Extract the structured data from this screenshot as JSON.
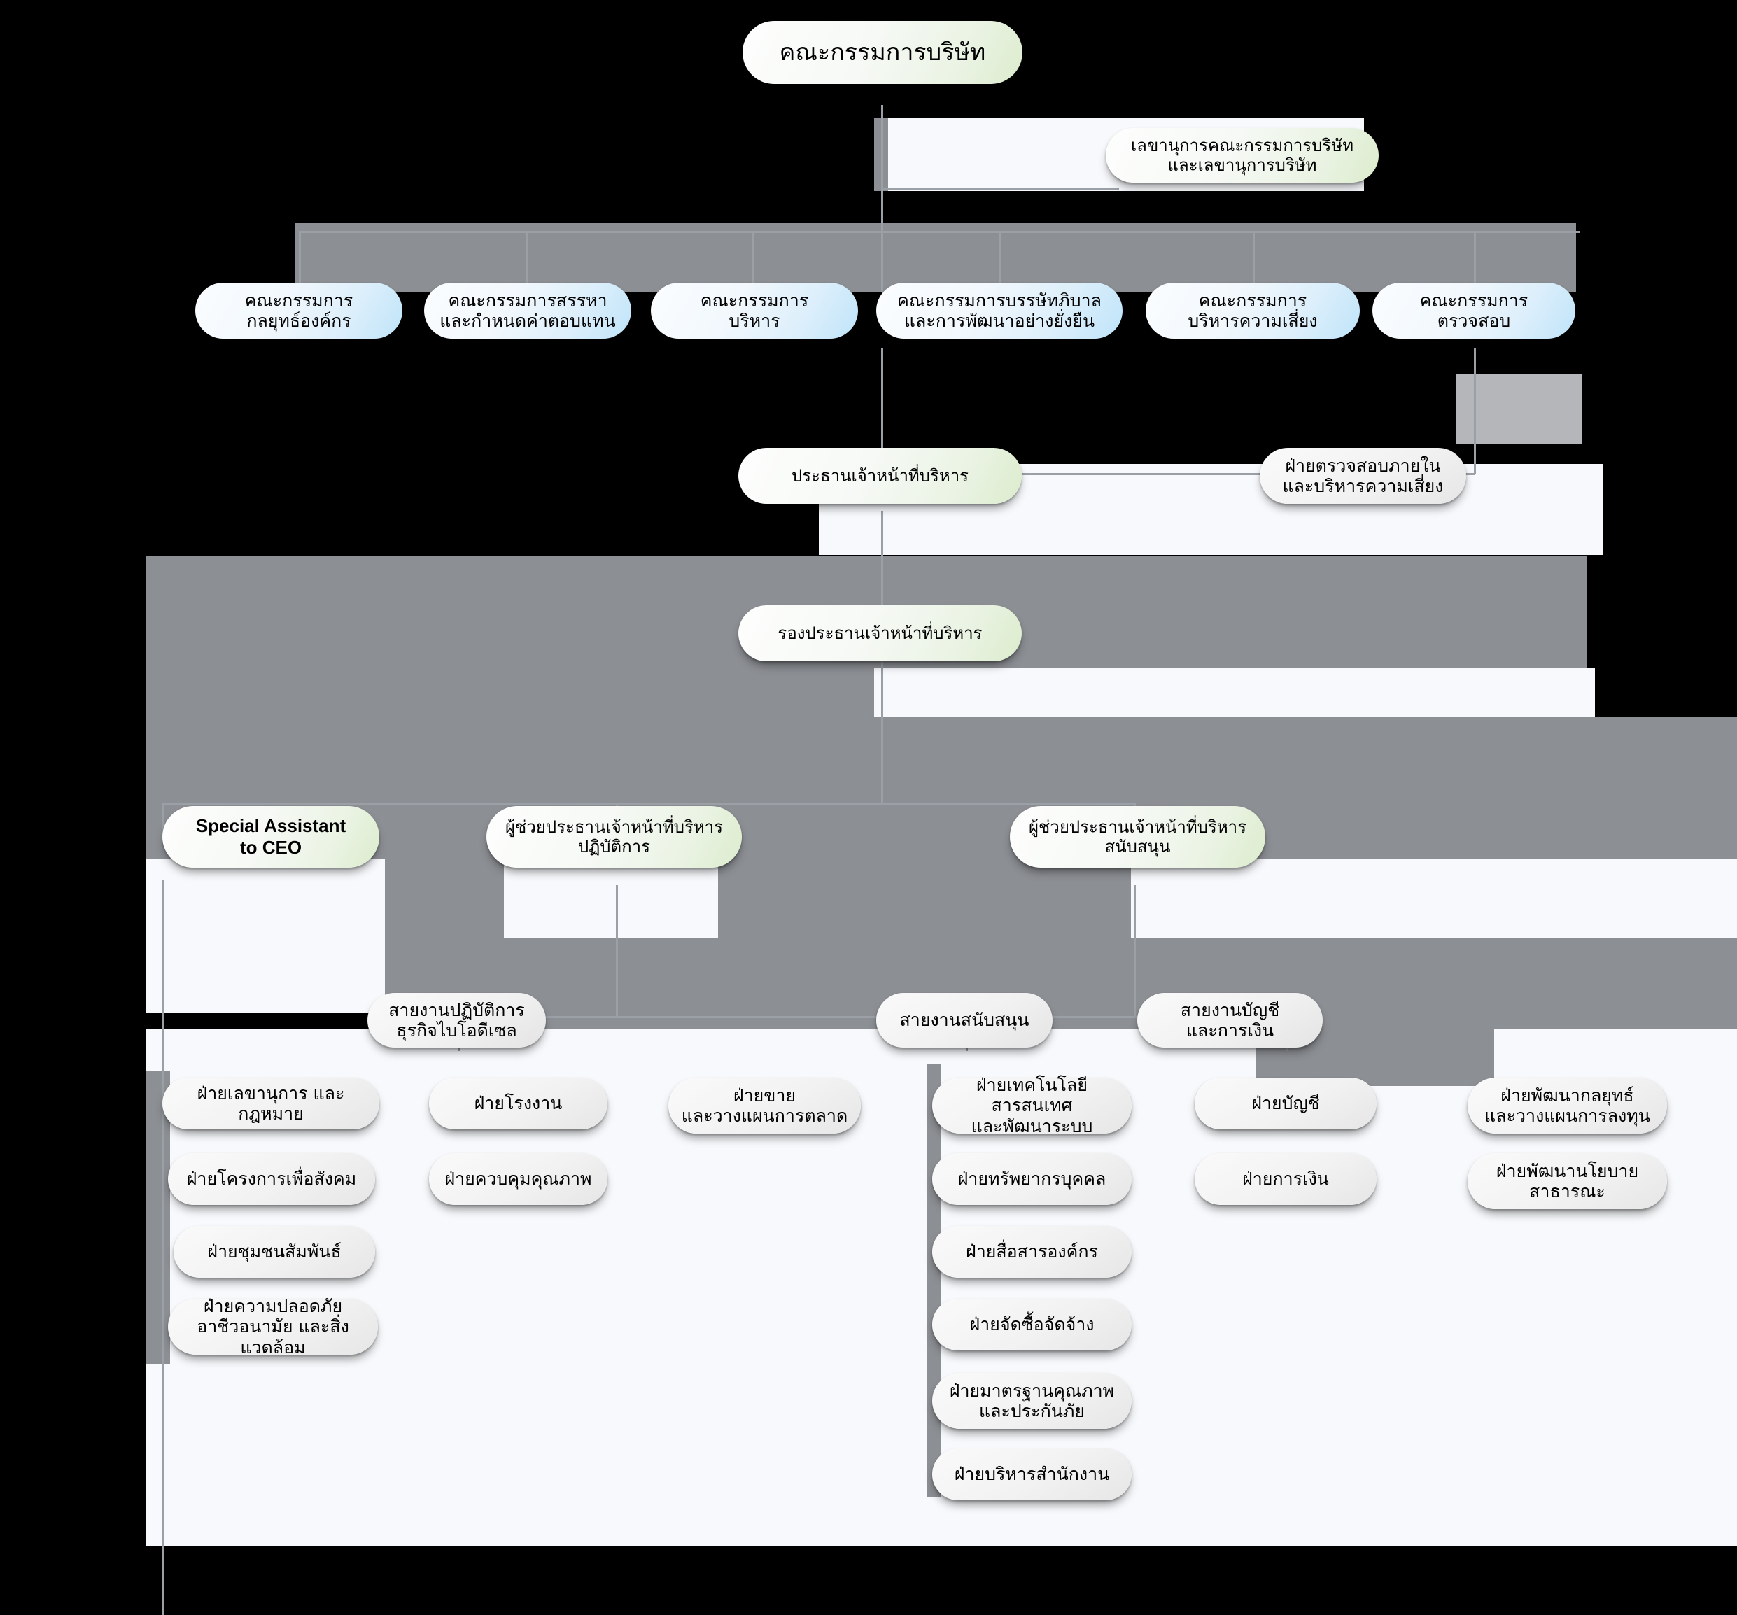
{
  "chart": {
    "type": "org-chart",
    "title": "คณะกรรมการบริษัท",
    "root": {
      "id": "board",
      "label": "คณะกรรมการบริษัท",
      "style": "executive"
    },
    "secretary": {
      "id": "company-secretary",
      "label": "เลขานุการคณะกรรมการบริษัท\nและเลขานุการบริษัท",
      "style": "executive"
    },
    "committees": [
      {
        "id": "corporate-strategy-committee",
        "label": "คณะกรรมการ\nกลยุทธ์องค์กร"
      },
      {
        "id": "nomination-remuneration-committee",
        "label": "คณะกรรมการสรรหา\nและกำหนดค่าตอบแทน"
      },
      {
        "id": "executive-committee",
        "label": "คณะกรรมการ\nบริหาร"
      },
      {
        "id": "governance-sustainability-committee",
        "label": "คณะกรรมการบรรษัทภิบาล\nและการพัฒนาอย่างยั่งยืน"
      },
      {
        "id": "risk-management-committee",
        "label": "คณะกรรมการ\nบริหารความเสี่ยง"
      },
      {
        "id": "audit-committee",
        "label": "คณะกรรมการ\nตรวจสอบ"
      }
    ],
    "ceo": {
      "id": "ceo",
      "label": "ประธานเจ้าหน้าที่บริหาร",
      "style": "executive"
    },
    "internal_audit": {
      "id": "internal-audit-risk-department",
      "label": "ฝ่ายตรวจสอบภายใน\nและบริหารความเสี่ยง",
      "style": "department"
    },
    "deputy_ceo": {
      "id": "deputy-ceo",
      "label": "รองประธานเจ้าหน้าที่บริหาร",
      "style": "executive"
    },
    "assistants": [
      {
        "id": "special-assistant-to-ceo",
        "label": "Special Assistant\nto CEO",
        "lang": "en"
      },
      {
        "id": "assistant-ceo-operations",
        "label": "ผู้ช่วยประธานเจ้าหน้าที่บริหาร\nปฏิบัติการ",
        "lang": "th"
      },
      {
        "id": "assistant-ceo-support",
        "label": "ผู้ช่วยประธานเจ้าหน้าที่บริหาร\nสนับสนุน",
        "lang": "th"
      }
    ],
    "divisions": [
      {
        "id": "biodiesel-operations-division",
        "label": "สายงานปฏิบัติการ\nธุรกิจไบโอดีเซล"
      },
      {
        "id": "support-division",
        "label": "สายงานสนับสนุน"
      },
      {
        "id": "accounting-finance-division",
        "label": "สายงานบัญชี\nและการเงิน"
      }
    ],
    "departments": {
      "special_assistant_group": [
        {
          "id": "secretary-legal-department",
          "label": "ฝ่ายเลขานุการ และ กฎหมาย"
        },
        {
          "id": "social-project-department",
          "label": "ฝ่ายโครงการเพื่อสังคม"
        },
        {
          "id": "community-relations-department",
          "label": "ฝ่ายชุมชนสัมพันธ์"
        },
        {
          "id": "safety-health-environment-department",
          "label": "ฝ่ายความปลอดภัย\nอาชีวอนามัย และสิ่งแวดล้อม"
        }
      ],
      "biodiesel_group": [
        {
          "id": "plant-department",
          "label": "ฝ่ายโรงงาน"
        },
        {
          "id": "quality-control-department",
          "label": "ฝ่ายควบคุมคุณภาพ"
        }
      ],
      "sales_group": [
        {
          "id": "sales-marketing-planning-department",
          "label": "ฝ่ายขาย\nและวางแผนการตลาด"
        }
      ],
      "support_group": [
        {
          "id": "it-system-development-department",
          "label": "ฝ่ายเทคโนโลยีสารสนเทศ\nและพัฒนาระบบ"
        },
        {
          "id": "human-resources-department",
          "label": "ฝ่ายทรัพยากรบุคคล"
        },
        {
          "id": "corporate-communications-department",
          "label": "ฝ่ายสื่อสารองค์กร"
        },
        {
          "id": "procurement-department",
          "label": "ฝ่ายจัดซื้อจัดจ้าง"
        },
        {
          "id": "quality-standard-insurance-department",
          "label": "ฝ่ายมาตรฐานคุณภาพ\nและประกันภัย"
        },
        {
          "id": "office-administration-department",
          "label": "ฝ่ายบริหารสำนักงาน"
        }
      ],
      "finance_group": [
        {
          "id": "accounting-department",
          "label": "ฝ่ายบัญชี"
        },
        {
          "id": "finance-department",
          "label": "ฝ่ายการเงิน"
        }
      ],
      "strategy_group": [
        {
          "id": "strategy-investment-planning-department",
          "label": "ฝ่ายพัฒนากลยุทธ์\nและวางแผนการลงทุน"
        },
        {
          "id": "public-policy-development-department",
          "label": "ฝ่ายพัฒนานโยบาย\nสาธารณะ"
        }
      ]
    },
    "colors": {
      "executive_node": "#eaf3e3",
      "committee_node": "#bfe4fa",
      "department_node": "#e6e6e6",
      "connector": "#9aa0a6",
      "background": "#000000"
    }
  }
}
